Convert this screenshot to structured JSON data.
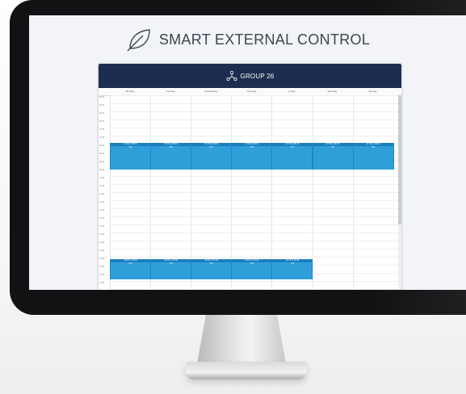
{
  "app": {
    "title": "SMART EXTERNAL CONTROL",
    "logo_icon": "leaf-icon"
  },
  "calendar": {
    "group_title": "GROUP 26",
    "group_icon": "network-nodes-icon",
    "days": [
      "Monday",
      "Tuesday",
      "Wednesday",
      "Thursday",
      "Friday",
      "Saturday",
      "Sunday"
    ],
    "times": [
      "05:00",
      "05:30",
      "06:00",
      "06:30",
      "07:00",
      "07:30",
      "08:00",
      "08:30",
      "09:00",
      "09:30",
      "10:00",
      "10:30",
      "11:00",
      "11:30",
      "12:00",
      "12:30",
      "13:00",
      "13:30",
      "14:00",
      "14:30",
      "15:00",
      "15:30",
      "16:00",
      "16:30",
      "17:00"
    ],
    "morning_events": [
      {
        "time": "07:15 to 08:15",
        "sub": "75%"
      },
      {
        "time": "07:15 to 08:15",
        "sub": "75%"
      },
      {
        "time": "07:15 to 08:15",
        "sub": "75%"
      },
      {
        "time": "07:15 to 08:15",
        "sub": "75%"
      },
      {
        "time": "07:15 to 08:15",
        "sub": "75%"
      },
      {
        "time": "07:15 to 08:15",
        "sub": "75%"
      },
      {
        "time": "07:15 to 08:15",
        "sub": "75%"
      }
    ],
    "afternoon_events": [
      {
        "time": "16:15 to 16:45",
        "sub": "75%"
      },
      {
        "time": "16:15 to 16:45",
        "sub": "75%"
      },
      {
        "time": "16:15 to 16:45",
        "sub": "75%"
      },
      {
        "time": "16:15 to 16:45",
        "sub": "75%"
      },
      {
        "time": "16:15 to 16:45",
        "sub": "75%"
      }
    ],
    "event_color": "#2f9fda",
    "header_color": "#1d2d50"
  }
}
